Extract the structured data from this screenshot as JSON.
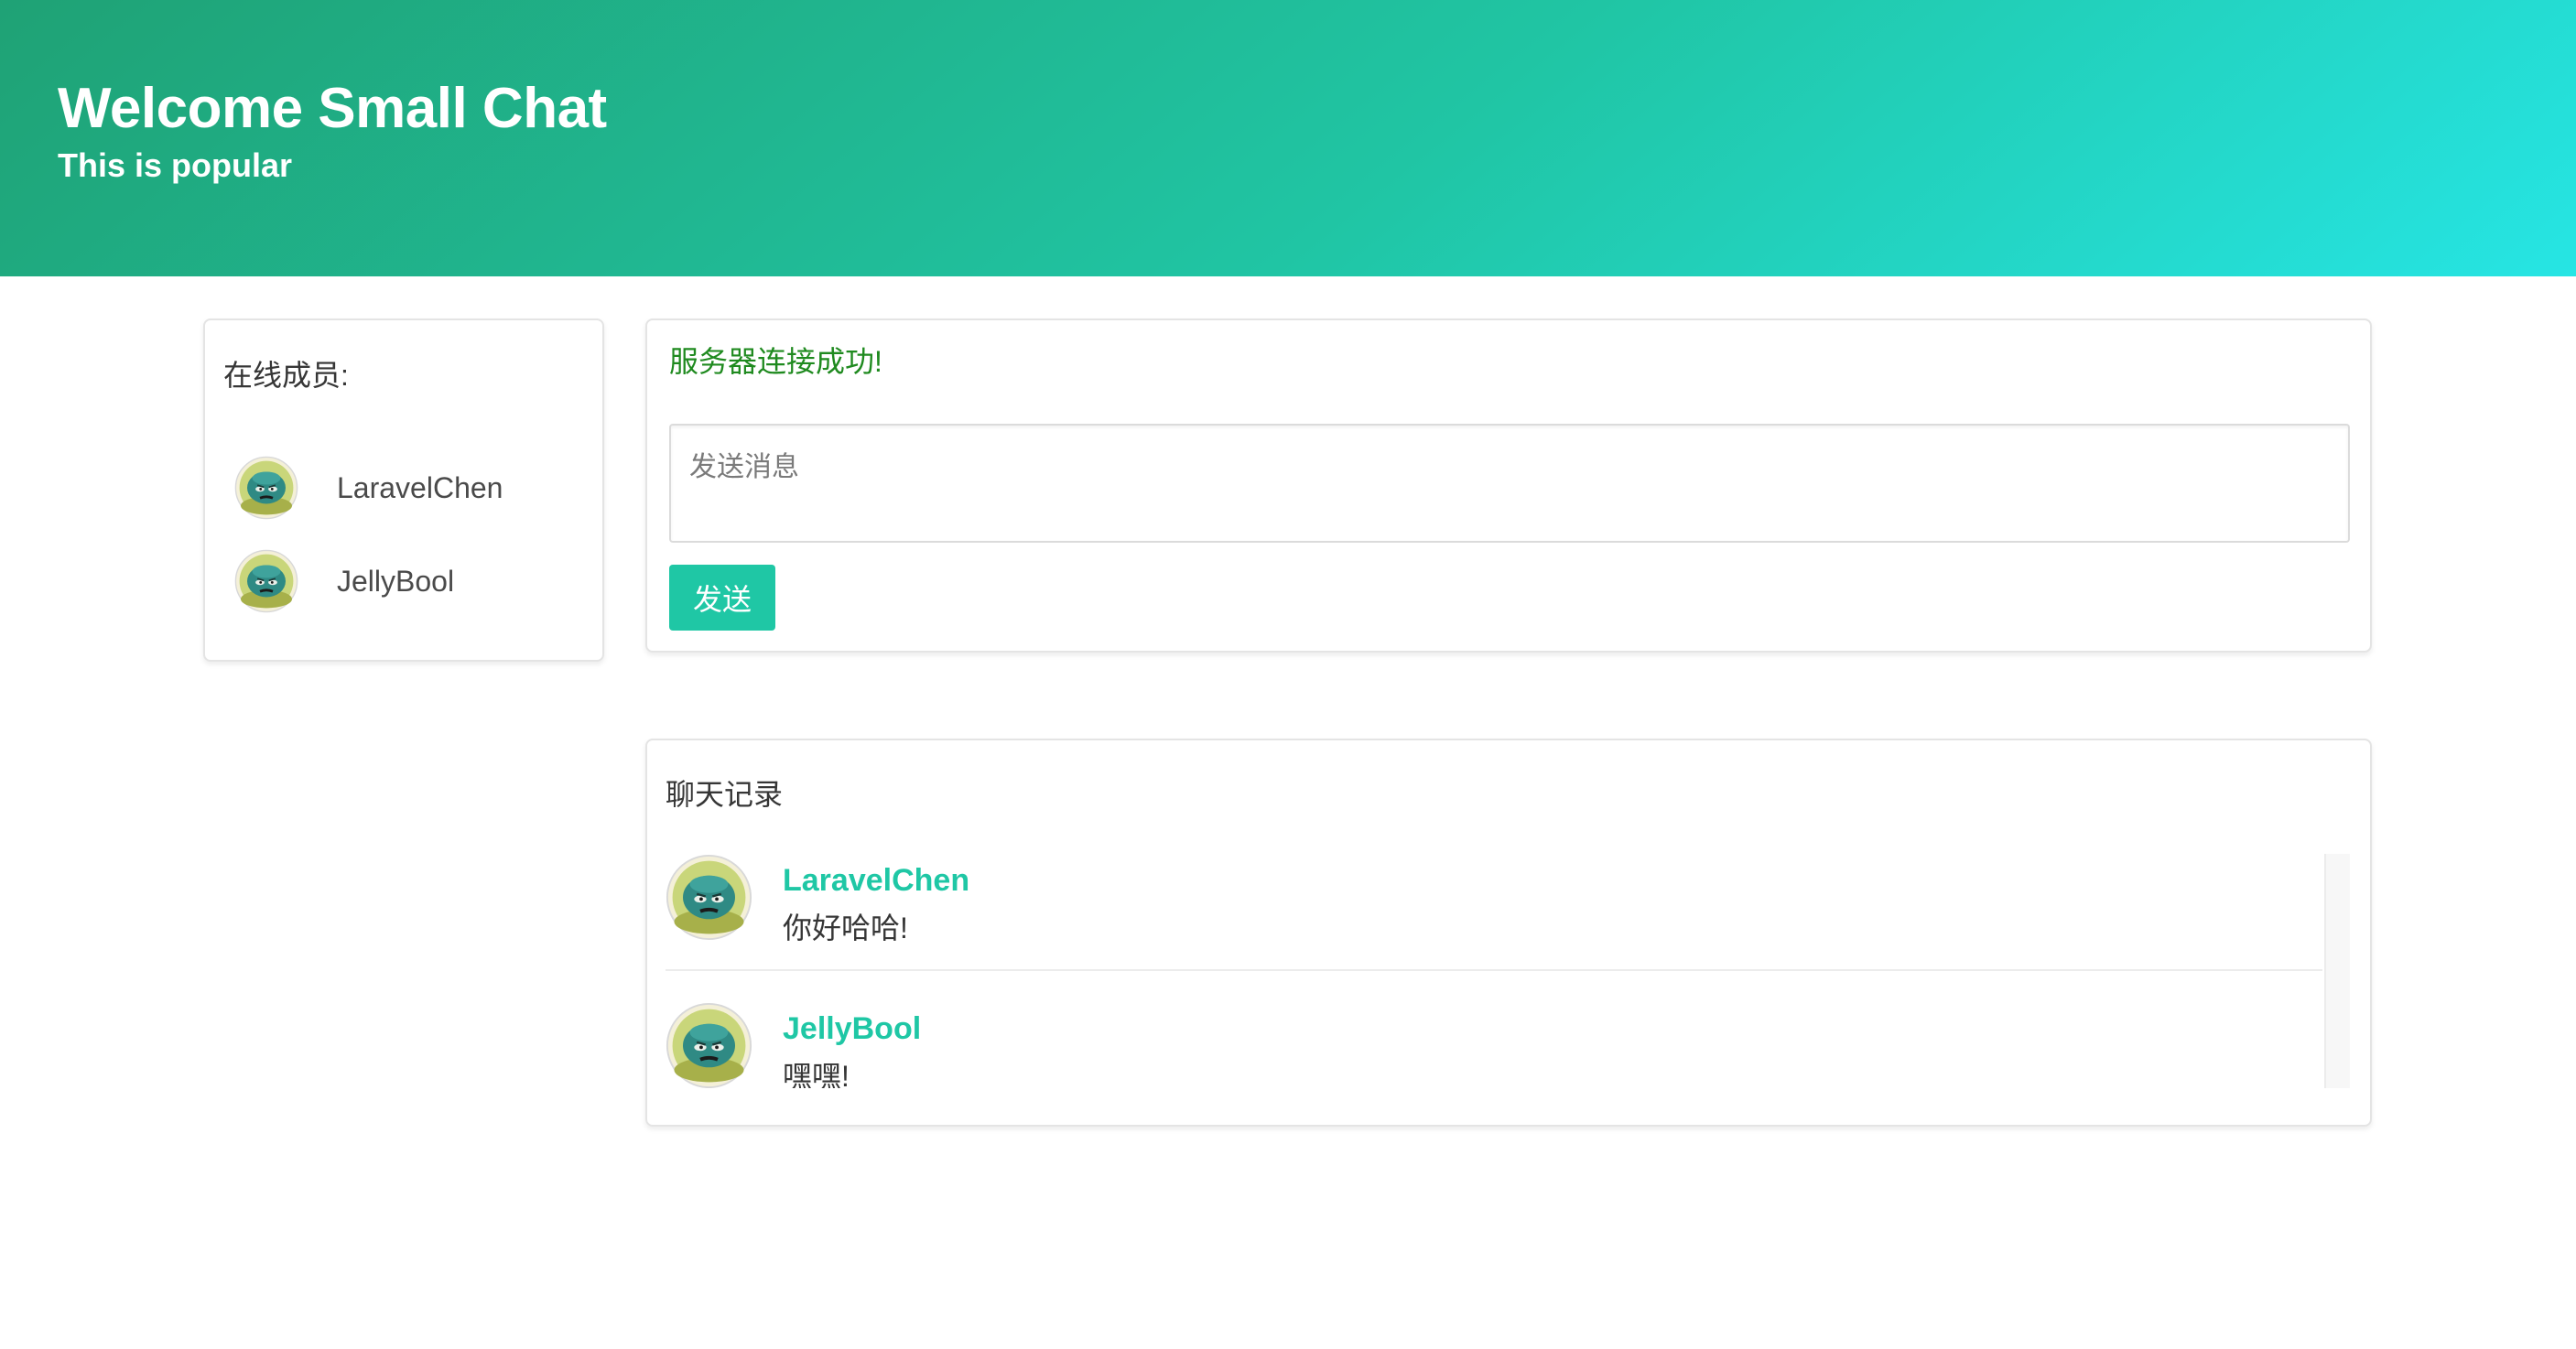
{
  "hero": {
    "title": "Welcome Small Chat",
    "subtitle": "This is popular",
    "gradient_colors": [
      "#1fa275",
      "#20c5a4",
      "#26e5e4"
    ]
  },
  "members": {
    "title": "在线成员:",
    "items": [
      {
        "name": "LaravelChen",
        "avatar_icon": "monster-avatar-icon"
      },
      {
        "name": "JellyBool",
        "avatar_icon": "monster-avatar-icon"
      }
    ]
  },
  "composer": {
    "status": "服务器连接成功!",
    "status_color": "#1f8a1f",
    "placeholder": "发送消息",
    "value": "",
    "send_label": "发送",
    "accent_color": "#1fc7a5"
  },
  "history": {
    "title": "聊天记录",
    "messages": [
      {
        "author": "LaravelChen",
        "text": "你好哈哈!",
        "avatar_icon": "monster-avatar-icon"
      },
      {
        "author": "JellyBool",
        "text": "嘿嘿!",
        "avatar_icon": "monster-avatar-icon"
      }
    ]
  }
}
